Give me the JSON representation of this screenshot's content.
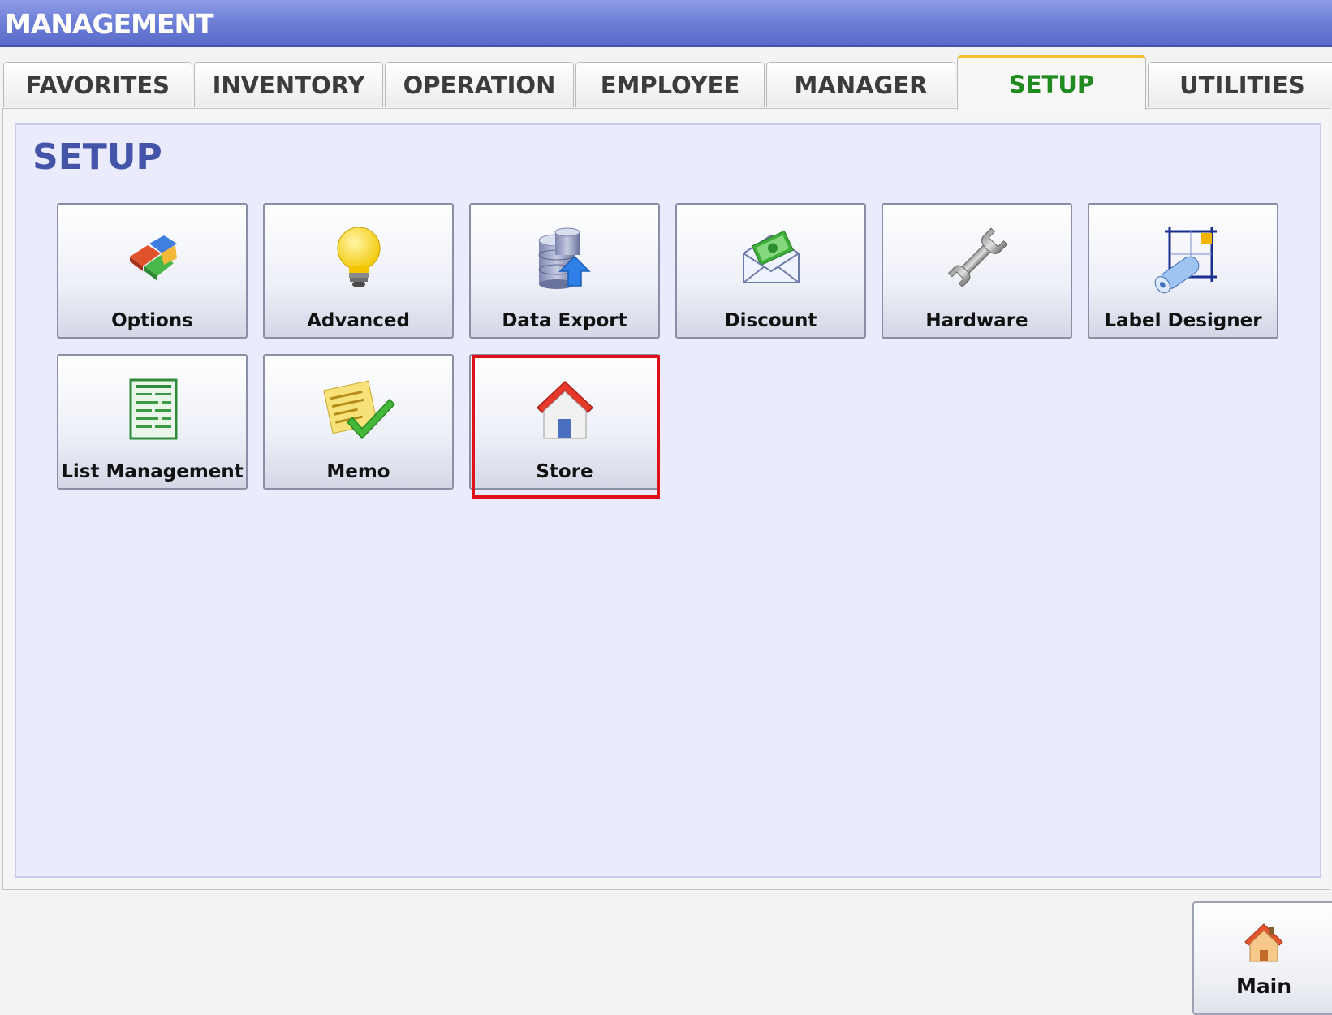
{
  "window": {
    "title": "MANAGEMENT"
  },
  "tabs": [
    {
      "label": "FAVORITES",
      "active": false
    },
    {
      "label": "INVENTORY",
      "active": false
    },
    {
      "label": "OPERATION",
      "active": false
    },
    {
      "label": "EMPLOYEE",
      "active": false
    },
    {
      "label": "MANAGER",
      "active": false
    },
    {
      "label": "SETUP",
      "active": true
    },
    {
      "label": "UTILITIES",
      "active": false
    }
  ],
  "panel": {
    "title": "SETUP",
    "buttons": [
      {
        "label": "Options",
        "icon": "puzzle-icon"
      },
      {
        "label": "Advanced",
        "icon": "lightbulb-icon"
      },
      {
        "label": "Data Export",
        "icon": "database-export-icon"
      },
      {
        "label": "Discount",
        "icon": "money-envelope-icon"
      },
      {
        "label": "Hardware",
        "icon": "wrench-icon"
      },
      {
        "label": "Label Designer",
        "icon": "label-roll-icon"
      },
      {
        "label": "List Management",
        "icon": "list-document-icon"
      },
      {
        "label": "Memo",
        "icon": "memo-check-icon"
      },
      {
        "label": "Store",
        "icon": "house-icon",
        "highlighted": true
      }
    ]
  },
  "footer": {
    "main_label": "Main",
    "main_icon": "house-icon"
  },
  "colors": {
    "title_bar": "#6f80d8",
    "active_tab_text": "#1f8a1f",
    "active_tab_accent": "#f1c232",
    "panel_bg": "#eaecfd",
    "panel_title": "#4454a8",
    "highlight": "#e0101a"
  }
}
